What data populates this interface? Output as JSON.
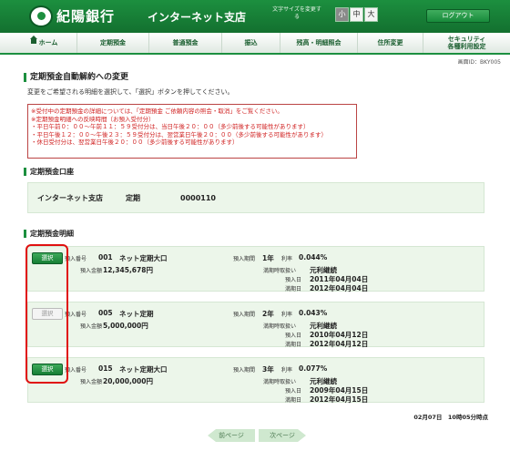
{
  "header": {
    "bank_name": "紀陽銀行",
    "site_name": "インターネット支店",
    "font_size_label": "文字サイズを変更する",
    "font_sizes": [
      "小",
      "中",
      "大"
    ],
    "logout": "ログアウト"
  },
  "nav": {
    "items": [
      "ホーム",
      "定期預金",
      "普通預金",
      "振込",
      "残高・明細照会",
      "住所変更",
      "セキュリティ\n各種利用設定"
    ]
  },
  "screen_id": "画面ID：BKY005",
  "page": {
    "title": "定期預金自動解約への変更",
    "description": "変更をご希望される明細を選択して、「選択」ボタンを押してください。"
  },
  "notice": {
    "lines": [
      "※受付中の定期預金の詳細については、「定期預金 ご依頼内容の照会・取消」をご覧ください。",
      "※定期預金明細への反映時間（お預入受付分）",
      "・平日午前０：００〜午前１１：５９受付分は、当日午後２０：００（多少前後する可能性があります）",
      "・平日午後１２：００〜午後２３：５９受付分は、翌営業日午後２０：００（多少前後する可能性があります）",
      "・休日受付分は、翌営業日午後２０：００（多少前後する可能性があります）"
    ]
  },
  "account_section": {
    "title": "定期預金口座",
    "branch": "インターネット支店",
    "type": "定期",
    "number": "0000110"
  },
  "details_section": {
    "title": "定期預金明細",
    "labels": {
      "deposit_no": "預入番号",
      "amount": "預入金額",
      "period": "預入期間",
      "rate": "利率",
      "maturity_handling": "満期時取扱い",
      "deposit_date": "預入日",
      "maturity_date": "満期日"
    },
    "rows": [
      {
        "select_label": "選択",
        "select_enabled": true,
        "deposit_no": "001",
        "product": "ネット定期大口",
        "amount": "12,345,678円",
        "period": "1年",
        "rate": "0.044%",
        "maturity_handling": "元利継続",
        "deposit_date": "2011年04月04日",
        "maturity_date": "2012年04月04日"
      },
      {
        "select_label": "選択",
        "select_enabled": false,
        "deposit_no": "005",
        "product": "ネット定期",
        "amount": "5,000,000円",
        "period": "2年",
        "rate": "0.043%",
        "maturity_handling": "元利継続",
        "deposit_date": "2010年04月12日",
        "maturity_date": "2012年04月12日"
      },
      {
        "select_label": "選択",
        "select_enabled": true,
        "deposit_no": "015",
        "product": "ネット定期大口",
        "amount": "20,000,000円",
        "period": "3年",
        "rate": "0.077%",
        "maturity_handling": "元利継続",
        "deposit_date": "2009年04月15日",
        "maturity_date": "2012年04月15日"
      }
    ]
  },
  "datetime": "02月07日　10時05分時点",
  "pager": {
    "prev": "前ページ",
    "next": "次ページ"
  },
  "colors": {
    "brand_green": "#1c8f3f",
    "notice_red": "#d02020",
    "highlight_red": "#e01010",
    "row_bg": "#ecf6ea"
  }
}
